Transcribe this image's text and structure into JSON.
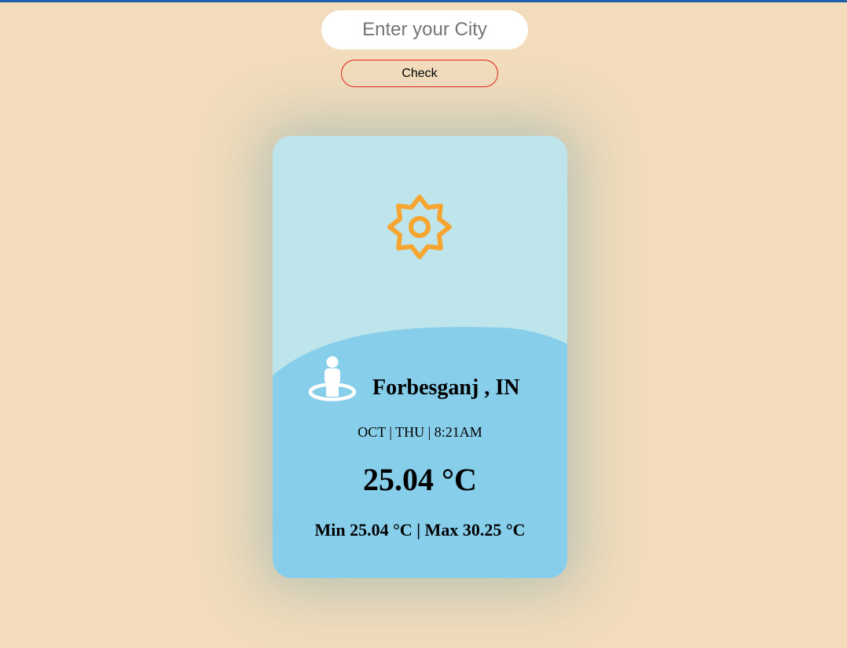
{
  "search": {
    "placeholder": "Enter your City",
    "value": ""
  },
  "check_button": {
    "label": "Check"
  },
  "weather_card": {
    "weather_icon": "sun-icon",
    "location_icon": "person-location-icon",
    "city": "Forbesganj , IN",
    "date_time": "OCT | THU | 8:21AM",
    "temperature": "25.04 °C",
    "min_max": "Min 25.04 °C | Max 30.25 °C"
  },
  "colors": {
    "background": "#f2dcbc",
    "card_top": "#bde5eb",
    "card_bottom": "#87ceeb",
    "sun": "#f7a530",
    "button_border": "#e0201c",
    "top_line": "#1f5ea8"
  }
}
